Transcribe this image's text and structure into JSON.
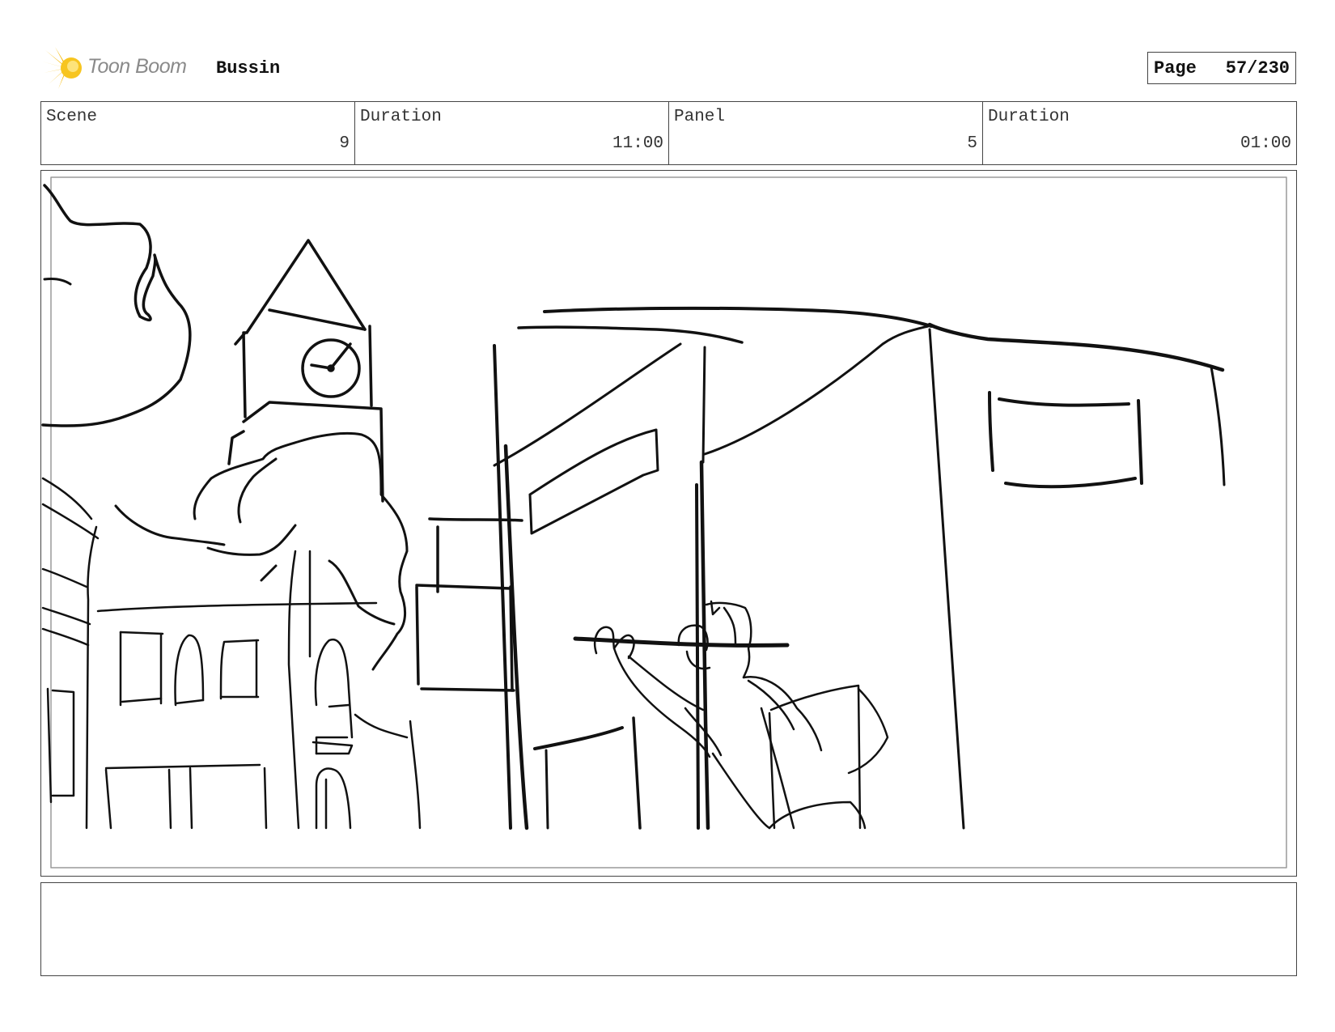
{
  "header": {
    "brand_name": "Toon Boom",
    "project_title": "Bussin",
    "page_label": "Page",
    "page_number": "57/230"
  },
  "info_bar": [
    {
      "label": "Scene",
      "value": "9"
    },
    {
      "label": "Duration",
      "value": "11:00"
    },
    {
      "label": "Panel",
      "value": "5"
    },
    {
      "label": "Duration",
      "value": "01:00"
    }
  ],
  "panel": {
    "sketch_subject": "city-street-sketch"
  },
  "notes": {
    "text": ""
  },
  "colors": {
    "logo_burst": "#f5b800",
    "logo_text": "#8a8a8a",
    "frame_border": "#444444",
    "inner_guide": "#9a9a9a"
  }
}
